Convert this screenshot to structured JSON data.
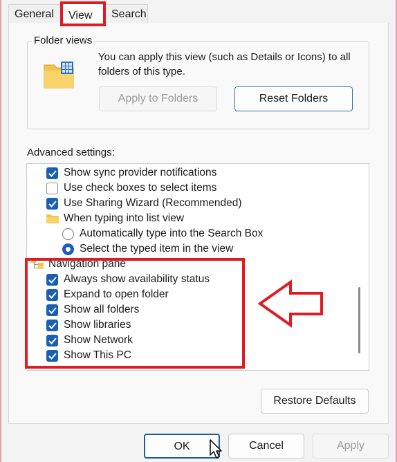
{
  "tabs": [
    {
      "label": "General"
    },
    {
      "label": "View"
    },
    {
      "label": "Search"
    }
  ],
  "folder_views": {
    "title": "Folder views",
    "description": "You can apply this view (such as Details or Icons) to all folders of this type.",
    "apply_button": "Apply to Folders",
    "reset_button": "Reset Folders"
  },
  "advanced": {
    "label": "Advanced settings:",
    "items": [
      {
        "type": "checkbox",
        "checked": true,
        "label": "Show sync provider notifications"
      },
      {
        "type": "checkbox",
        "checked": false,
        "label": "Use check boxes to select items"
      },
      {
        "type": "checkbox",
        "checked": true,
        "label": "Use Sharing Wizard (Recommended)"
      },
      {
        "type": "folder",
        "label": "When typing into list view"
      },
      {
        "type": "radio",
        "checked": false,
        "label": "Automatically type into the Search Box"
      },
      {
        "type": "radio",
        "checked": true,
        "label": "Select the typed item in the view"
      },
      {
        "type": "nav-folder",
        "label": "Navigation pane"
      },
      {
        "type": "checkbox",
        "checked": true,
        "label": "Always show availability status"
      },
      {
        "type": "checkbox",
        "checked": true,
        "label": "Expand to open folder"
      },
      {
        "type": "checkbox",
        "checked": true,
        "label": "Show all folders"
      },
      {
        "type": "checkbox",
        "checked": true,
        "label": "Show libraries"
      },
      {
        "type": "checkbox",
        "checked": true,
        "label": "Show Network"
      },
      {
        "type": "checkbox",
        "checked": true,
        "label": "Show This PC"
      }
    ]
  },
  "restore_button": "Restore Defaults",
  "footer": {
    "ok": "OK",
    "cancel": "Cancel",
    "apply": "Apply"
  },
  "colors": {
    "accent": "#1a5fb4",
    "annotation": "#e01b24"
  }
}
